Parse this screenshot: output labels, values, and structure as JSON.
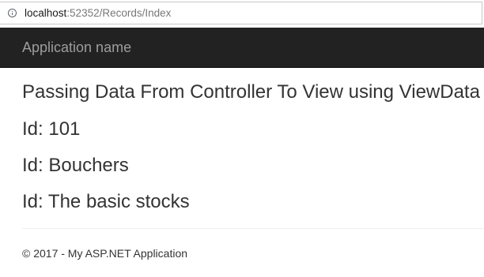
{
  "browser": {
    "url_host": "localhost",
    "url_path": ":52352/Records/Index",
    "info_icon": "info-circle-icon"
  },
  "navbar": {
    "brand": "Application name"
  },
  "main": {
    "heading": "Passing Data From Controller To View using ViewData",
    "lines": [
      {
        "label": "Id: ",
        "value": "101"
      },
      {
        "label": "Id: ",
        "value": "Bouchers"
      },
      {
        "label": "Id: ",
        "value": "The basic stocks"
      }
    ]
  },
  "footer": {
    "text": "© 2017 - My ASP.NET Application"
  },
  "colors": {
    "navbar_bg": "#222222",
    "brand_text": "#9d9d9d",
    "body_text": "#333333"
  }
}
